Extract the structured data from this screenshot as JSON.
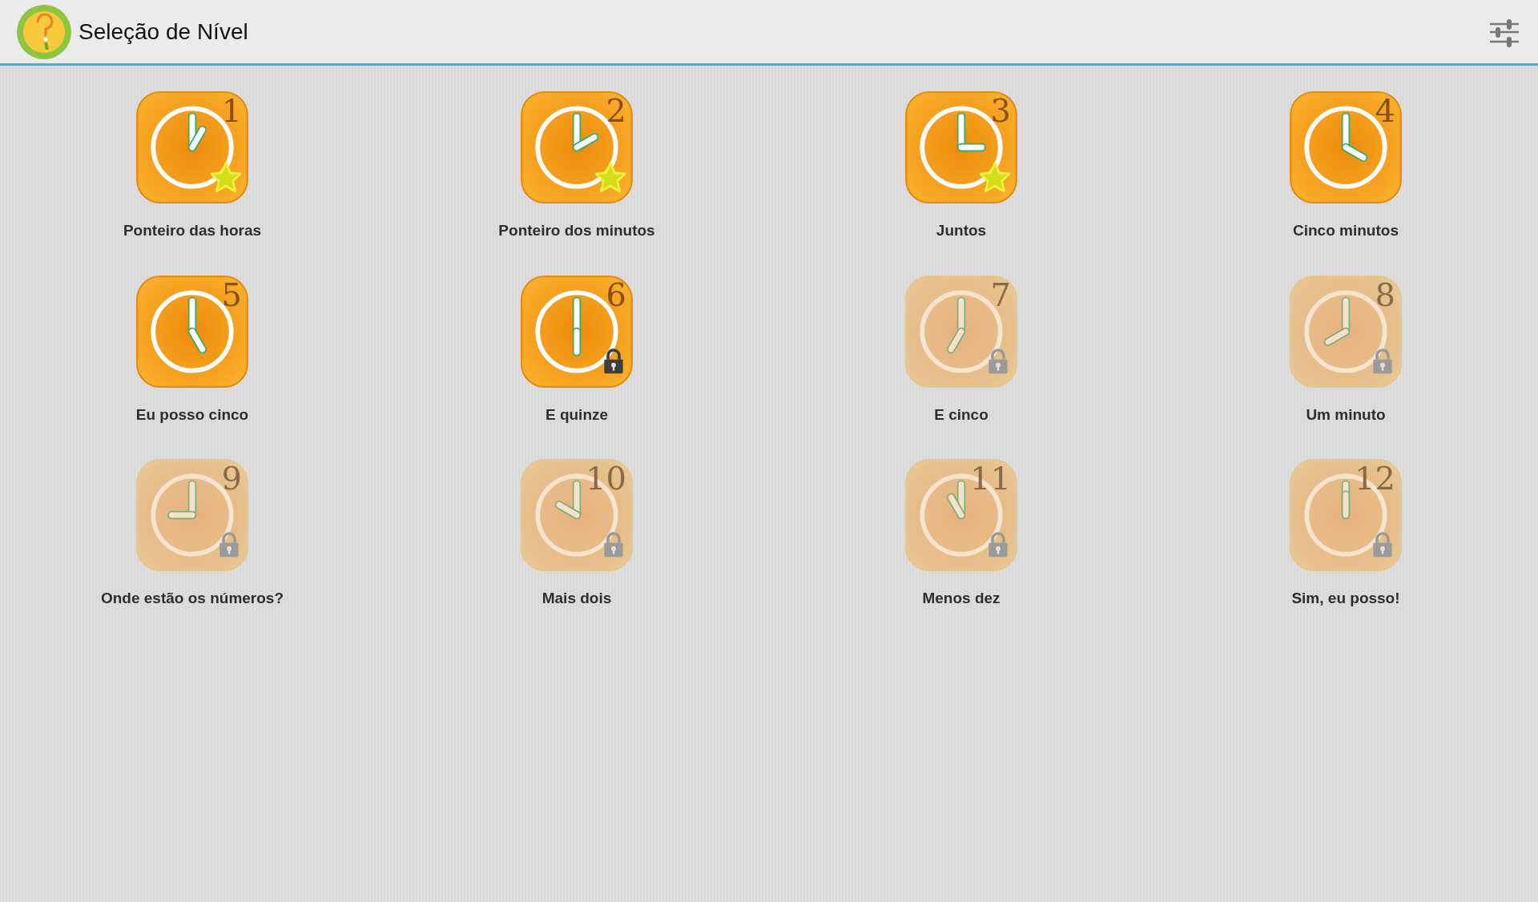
{
  "app_bar": {
    "title": "Seleção de Nível"
  },
  "levels": [
    {
      "number": "1",
      "title": "Ponteiro das horas",
      "starred": true,
      "locked": false,
      "available": true
    },
    {
      "number": "2",
      "title": "Ponteiro dos minutos",
      "starred": true,
      "locked": false,
      "available": true
    },
    {
      "number": "3",
      "title": "Juntos",
      "starred": true,
      "locked": false,
      "available": true
    },
    {
      "number": "4",
      "title": "Cinco minutos",
      "starred": false,
      "locked": false,
      "available": true
    },
    {
      "number": "5",
      "title": "Eu posso cinco",
      "starred": false,
      "locked": false,
      "available": true
    },
    {
      "number": "6",
      "title": "E quinze",
      "starred": false,
      "locked": true,
      "available": true
    },
    {
      "number": "7",
      "title": "E cinco",
      "starred": false,
      "locked": true,
      "available": false
    },
    {
      "number": "8",
      "title": "Um minuto",
      "starred": false,
      "locked": true,
      "available": false
    },
    {
      "number": "9",
      "title": "Onde estão os números?",
      "starred": false,
      "locked": true,
      "available": false
    },
    {
      "number": "10",
      "title": "Mais dois",
      "starred": false,
      "locked": true,
      "available": false
    },
    {
      "number": "11",
      "title": "Menos dez",
      "starred": false,
      "locked": true,
      "available": false
    },
    {
      "number": "12",
      "title": "Sim, eu posso!",
      "starred": false,
      "locked": true,
      "available": false
    }
  ]
}
